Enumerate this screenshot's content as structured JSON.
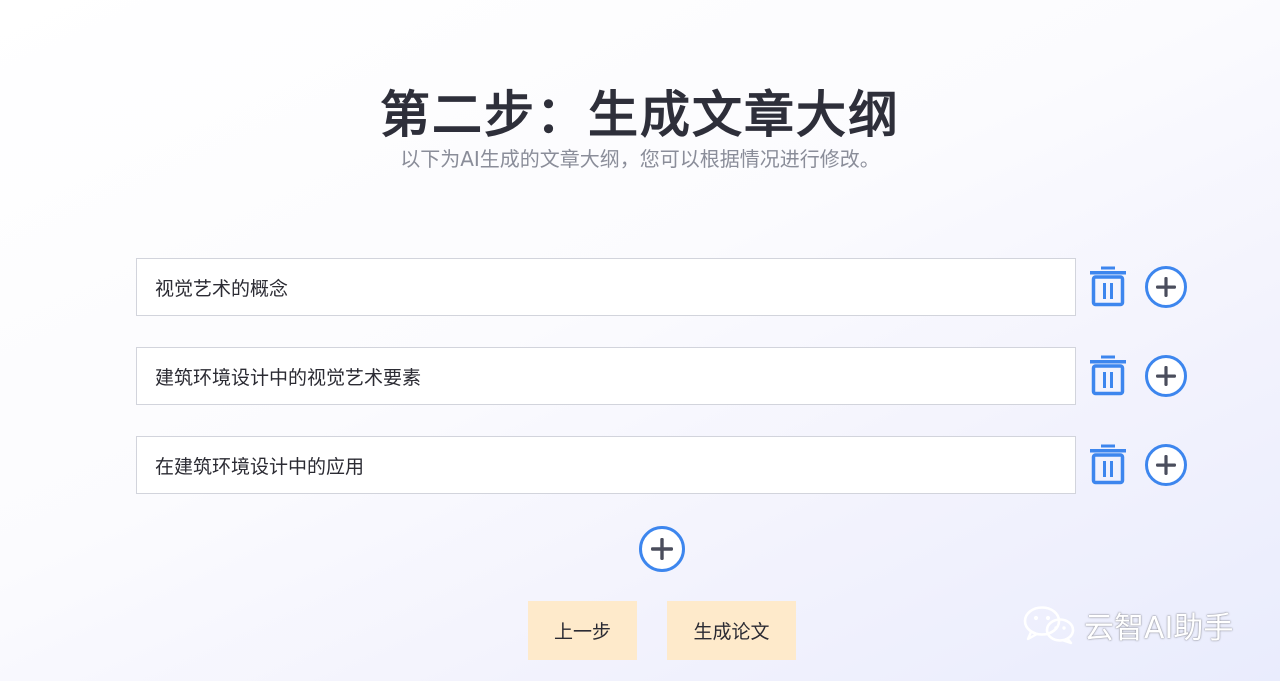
{
  "header": {
    "title": "第二步：生成文章大纲",
    "subtitle": "以下为AI生成的文章大纲，您可以根据情况进行修改。"
  },
  "outline": {
    "items": [
      {
        "value": "视觉艺术的概念",
        "delete_icon": "trash-icon",
        "add_icon": "plus-circle-icon"
      },
      {
        "value": "建筑环境设计中的视觉艺术要素",
        "delete_icon": "trash-icon",
        "add_icon": "plus-circle-icon"
      },
      {
        "value": "在建筑环境设计中的应用",
        "delete_icon": "trash-icon",
        "add_icon": "plus-circle-icon"
      }
    ],
    "add_item_icon": "plus-circle-icon"
  },
  "actions": {
    "prev_label": "上一步",
    "generate_label": "生成论文"
  },
  "watermark": {
    "icon": "wechat-icon",
    "text": "云智AI助手"
  },
  "colors": {
    "accent_blue": "#3d86ee",
    "button_bg": "#feeacb",
    "title": "#2e2f3a",
    "subtitle": "#8a8d99"
  }
}
